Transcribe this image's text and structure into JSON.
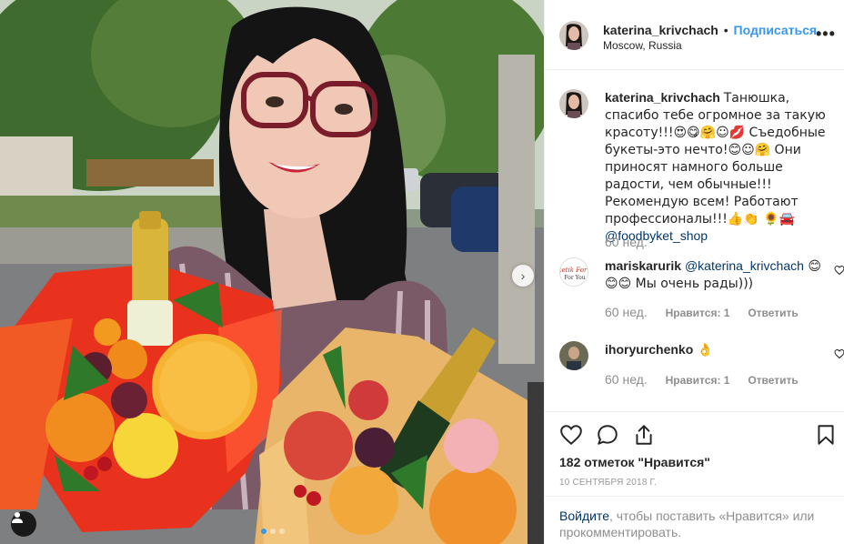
{
  "post": {
    "author": "katerina_krivchach",
    "separator": "•",
    "follow_label": "Подписаться",
    "location": "Moscow, Russia",
    "more_icon": "more-horizontal-icon",
    "more_label": "•••"
  },
  "photo": {
    "next_icon": "chevron-right-icon",
    "next_label": "›",
    "dots_total": 3,
    "dots_active": 0,
    "user_tag_icon": "user-icon"
  },
  "comments": [
    {
      "user": "katerina_krivchach",
      "text_before": "Танюшка, спасибо тебе огромное за такую красоту!!!😍😋🤗☺💋 Съедобные букеты-это нечто!😊☺🤗 Они приносят намного больше радости, чем обычные!!! Рекомендую всем! Работают профессионалы!!!👍👏 🌻🚘 ",
      "mention": "@foodbyket_shop",
      "text_after": "",
      "time": "60 нед.",
      "like_label": "",
      "reply_label": ""
    },
    {
      "user": "mariskarurik",
      "text_before": " ",
      "mention": "@katerina_krivchach",
      "text_after": " 😊 😊😊 Мы очень рады)))",
      "time": "60 нед.",
      "like_label": "Нравится: 1",
      "reply_label": "Ответить",
      "avatar_text": "Buketik For You"
    },
    {
      "user": "ihoryurchenko",
      "text_before": " 👌",
      "mention": "",
      "text_after": "",
      "time": "60 нед.",
      "like_label": "Нравится: 1",
      "reply_label": "Ответить"
    }
  ],
  "actions": {
    "like_icon": "heart-icon",
    "comment_icon": "comment-icon",
    "share_icon": "share-icon",
    "save_icon": "bookmark-icon",
    "likes_count_label": "182 отметок \"Нравится\"",
    "date": "10 сентября 2018 г.",
    "login_link": "Войдите",
    "login_text": ", чтобы поставить «Нравится» или прокомментировать."
  },
  "colors": {
    "accent": "#3897f0",
    "text": "#262626",
    "muted": "#8e8e8e",
    "border": "#efefef",
    "link": "#003569"
  }
}
